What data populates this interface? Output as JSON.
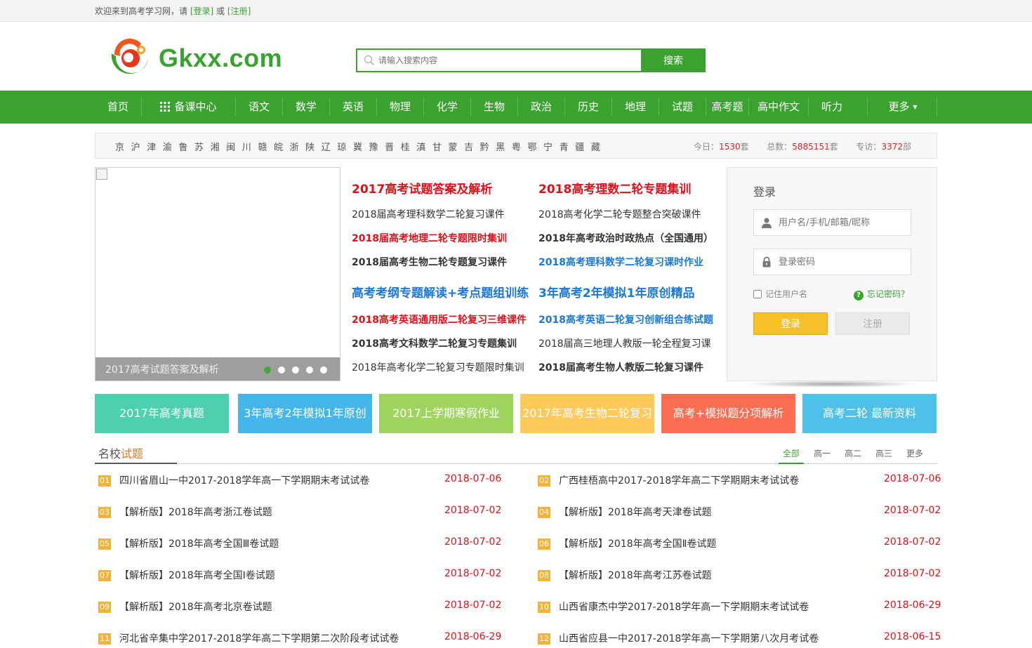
{
  "topbar": {
    "welcome": "欢迎来到高考学习网，请",
    "login": "[登录]",
    "or": "或",
    "register": "[注册]"
  },
  "header": {
    "logo_text": "Gkxx.com",
    "search_placeholder": "请输入搜索内容",
    "search_button": "搜索"
  },
  "nav": {
    "items": [
      "首页",
      "备课中心",
      "语文",
      "数学",
      "英语",
      "物理",
      "化学",
      "生物",
      "政治",
      "历史",
      "地理",
      "试题",
      "高考题",
      "高中作文",
      "听力",
      "更多"
    ]
  },
  "regions": {
    "provinces": [
      "京",
      "沪",
      "津",
      "渝",
      "鲁",
      "苏",
      "湘",
      "闽",
      "川",
      "赣",
      "皖",
      "浙",
      "陕",
      "辽",
      "琼",
      "冀",
      "豫",
      "晋",
      "桂",
      "滇",
      "甘",
      "蒙",
      "吉",
      "黔",
      "黑",
      "粤",
      "鄂",
      "宁",
      "青",
      "疆",
      "藏"
    ],
    "today_label": "今日：",
    "today_value": "1530",
    "today_unit": "套",
    "total_label": "总数：",
    "total_value": "5885151",
    "total_unit": "套",
    "special_label": "专访：",
    "special_value": "3372",
    "special_unit": "部"
  },
  "slider": {
    "caption": "2017高考试题答案及解析",
    "dots": 5,
    "active_dot": 0
  },
  "news": {
    "left": {
      "top_head": "2017高考试题答案及解析",
      "top_items": [
        {
          "text": "2018届高考理科数学二轮复习课件",
          "style": "dark"
        },
        {
          "text": "2018届高考地理二轮专题限时集训",
          "style": "red bold"
        },
        {
          "text": "2018届高考生物二轮专题复习课件",
          "style": "dark bold"
        }
      ],
      "bottom_head": "高考考纲专题解读+考点题组训练",
      "bottom_items": [
        {
          "text": "2018高考英语通用版二轮复习三维课件",
          "style": "red bold"
        },
        {
          "text": "2018高考文科数学二轮复习专题集训",
          "style": "dark bold"
        },
        {
          "text": "2018年高考化学二轮复习专题限时集训",
          "style": "dark"
        }
      ]
    },
    "right": {
      "top_head": "2018高考理数二轮专题集训",
      "top_items": [
        {
          "text": "2018高考化学二轮专题整合突破课件",
          "style": "dark"
        },
        {
          "text": "2018年高考政治时政热点（全国通用）",
          "style": "dark bold"
        },
        {
          "text": "2018高考理科数学二轮复习课时作业",
          "style": "blue bold"
        }
      ],
      "bottom_head": "3年高考2年模拟1年原创精品",
      "bottom_items": [
        {
          "text": "2018高考英语二轮复习创新组合练试题",
          "style": "blue bold"
        },
        {
          "text": "2018届高三地理人教版一轮全程复习课",
          "style": "dark"
        },
        {
          "text": "2018届高考生物人教版二轮复习课件",
          "style": "dark bold"
        }
      ]
    }
  },
  "login": {
    "title": "登录",
    "username_placeholder": "用户名/手机/邮箱/昵称",
    "password_placeholder": "登录密码",
    "remember": "记住用户名",
    "forgot": "忘记密码？",
    "login_button": "登录",
    "register_button": "注册"
  },
  "tiles": [
    {
      "label": "2017年高考真题",
      "color": "#4ecfae"
    },
    {
      "label": "3年高考2年模拟1年原创",
      "color": "#44b6ea"
    },
    {
      "label": "2017上学期寒假作业",
      "color": "#9fd45f"
    },
    {
      "label": "2017年高考生物二轮复习",
      "color": "#fdc95a"
    },
    {
      "label": "高考+模拟题分项解析",
      "color": "#fb6e52"
    },
    {
      "label": "高考二轮 最新资料",
      "color": "#4fc1e9"
    }
  ],
  "section": {
    "title_prefix": "名校",
    "title_highlight": "试题",
    "tabs": [
      "全部",
      "高一",
      "高二",
      "高三",
      "更多"
    ],
    "active_tab": 0
  },
  "list": [
    {
      "num": "01",
      "title": "四川省眉山一中2017-2018学年高一下学期期末考试试卷",
      "date": "2018-07-06"
    },
    {
      "num": "02",
      "title": "广西桂梧高中2017-2018学年高二下学期期末考试试卷",
      "date": "2018-07-06"
    },
    {
      "num": "03",
      "title": "【解析版】2018年高考浙江卷试题",
      "date": "2018-07-02"
    },
    {
      "num": "04",
      "title": "【解析版】2018年高考天津卷试题",
      "date": "2018-07-02"
    },
    {
      "num": "05",
      "title": "【解析版】2018年高考全国Ⅲ卷试题",
      "date": "2018-07-02"
    },
    {
      "num": "06",
      "title": "【解析版】2018年高考全国Ⅱ卷试题",
      "date": "2018-07-02"
    },
    {
      "num": "07",
      "title": "【解析版】2018年高考全国Ⅰ卷试题",
      "date": "2018-07-02"
    },
    {
      "num": "08",
      "title": "【解析版】2018年高考江苏卷试题",
      "date": "2018-07-02"
    },
    {
      "num": "09",
      "title": "【解析版】2018年高考北京卷试题",
      "date": "2018-07-02"
    },
    {
      "num": "10",
      "title": "山西省康杰中学2017-2018学年高一下学期期末考试试卷",
      "date": "2018-06-29"
    },
    {
      "num": "11",
      "title": "河北省辛集中学2017-2018学年高二下学期第二次阶段考试试卷",
      "date": "2018-06-29"
    },
    {
      "num": "12",
      "title": "山西省应县一中2017-2018学年高一下学期第八次月考试卷",
      "date": "2018-06-15"
    }
  ],
  "colors": {
    "brand_green": "#3aa330",
    "date_red": "#e0101a",
    "number_orange": "#f2b33d",
    "login_yellow": "#f6c02a"
  }
}
